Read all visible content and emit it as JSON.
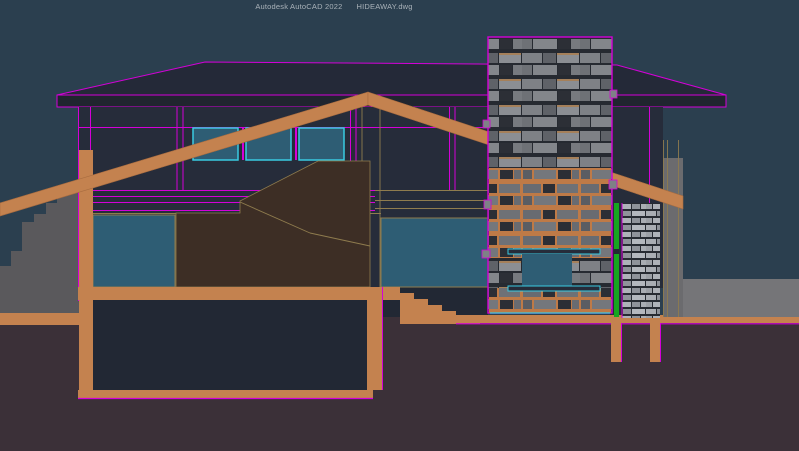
{
  "window": {
    "app_title": "Autodesk AutoCAD 2022",
    "doc_title": "HIDEAWAY.dwg"
  },
  "canvas": {
    "description": "Building cross-section elevation drawing of a hillside house with stone chimney, gable beams, clerestory windows, basement and exterior grade",
    "scene_elements": [
      "roof",
      "fascia",
      "clerestory windows",
      "gable beams",
      "stone chimney",
      "firebox window",
      "stone pier",
      "interior wall",
      "main floor slab",
      "stairs",
      "basement room",
      "footings",
      "grade line",
      "hillside terrain"
    ],
    "colors": {
      "slate": "#2B3F4F",
      "roofTop": "#242938",
      "roofFace": "#20252F",
      "wall": "#262C3A",
      "basementNavy": "#222834",
      "ground": "#3B3038",
      "grayLeft": "#5A595C",
      "grayRight": "#757578",
      "grayCol": "#6B6B6E",
      "orange": "#C4824F",
      "orangeDark": "#A86C40",
      "magenta": "#D400D8",
      "cyan": "#39CBE2",
      "teal": "#2E5D74",
      "brown": "#3D2E25",
      "tan": "#8F7C4E",
      "green": "#17A520",
      "stoneGray": "#7E8186",
      "stoneJoint": "#262A31",
      "stoneMortar": "#BE7A47",
      "titleText": "#A9B2B9"
    }
  }
}
